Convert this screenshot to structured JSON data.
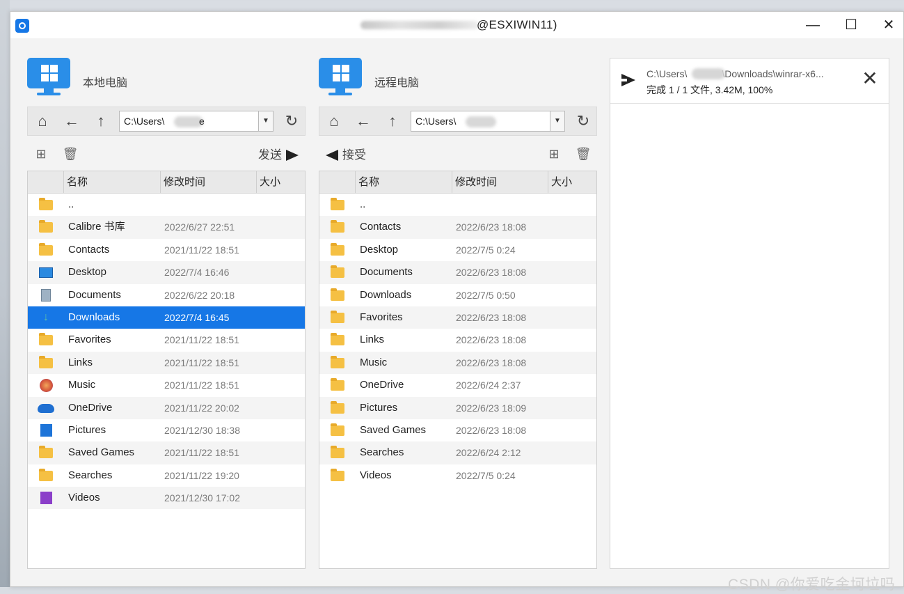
{
  "window": {
    "title": "@ESXIWIN11)",
    "minimize": "—",
    "maximize": "☐",
    "close": "✕"
  },
  "local": {
    "title": "本地电脑",
    "path": "C:\\Users\\",
    "path_suffix": "e",
    "send_label": "发送",
    "columns": [
      "名称",
      "修改时间",
      "大小"
    ],
    "files": [
      {
        "icon": "folder-icon",
        "name": "..",
        "date": ""
      },
      {
        "icon": "folder-icon",
        "name": "Calibre 书库",
        "date": "2022/6/27 22:51"
      },
      {
        "icon": "folder-icon",
        "name": "Contacts",
        "date": "2021/11/22 18:51"
      },
      {
        "icon": "desktop-folder-icon",
        "name": "Desktop",
        "date": "2022/7/4 16:46"
      },
      {
        "icon": "documents-folder-icon",
        "name": "Documents",
        "date": "2022/6/22 20:18"
      },
      {
        "icon": "downloads-folder-icon",
        "name": "Downloads",
        "date": "2022/7/4 16:45",
        "selected": true
      },
      {
        "icon": "folder-icon",
        "name": "Favorites",
        "date": "2021/11/22 18:51"
      },
      {
        "icon": "folder-icon",
        "name": "Links",
        "date": "2021/11/22 18:51"
      },
      {
        "icon": "music-folder-icon",
        "name": "Music",
        "date": "2021/11/22 18:51"
      },
      {
        "icon": "onedrive-icon",
        "name": "OneDrive",
        "date": "2021/11/22 20:02"
      },
      {
        "icon": "pictures-folder-icon",
        "name": "Pictures",
        "date": "2021/12/30 18:38"
      },
      {
        "icon": "folder-icon",
        "name": "Saved Games",
        "date": "2021/11/22 18:51"
      },
      {
        "icon": "folder-icon",
        "name": "Searches",
        "date": "2021/11/22 19:20"
      },
      {
        "icon": "videos-folder-icon",
        "name": "Videos",
        "date": "2021/12/30 17:02"
      }
    ]
  },
  "remote": {
    "title": "远程电脑",
    "path": "C:\\Users\\",
    "recv_label": "接受",
    "columns": [
      "名称",
      "修改时间",
      "大小"
    ],
    "files": [
      {
        "icon": "folder-icon",
        "name": "..",
        "date": ""
      },
      {
        "icon": "folder-icon",
        "name": "Contacts",
        "date": "2022/6/23 18:08"
      },
      {
        "icon": "folder-icon",
        "name": "Desktop",
        "date": "2022/7/5 0:24"
      },
      {
        "icon": "folder-icon",
        "name": "Documents",
        "date": "2022/6/23 18:08"
      },
      {
        "icon": "folder-icon",
        "name": "Downloads",
        "date": "2022/7/5 0:50"
      },
      {
        "icon": "folder-icon",
        "name": "Favorites",
        "date": "2022/6/23 18:08"
      },
      {
        "icon": "folder-icon",
        "name": "Links",
        "date": "2022/6/23 18:08"
      },
      {
        "icon": "folder-icon",
        "name": "Music",
        "date": "2022/6/23 18:08"
      },
      {
        "icon": "folder-icon",
        "name": "OneDrive",
        "date": "2022/6/24 2:37"
      },
      {
        "icon": "folder-icon",
        "name": "Pictures",
        "date": "2022/6/23 18:09"
      },
      {
        "icon": "folder-icon",
        "name": "Saved Games",
        "date": "2022/6/23 18:08"
      },
      {
        "icon": "folder-icon",
        "name": "Searches",
        "date": "2022/6/24 2:12"
      },
      {
        "icon": "folder-icon",
        "name": "Videos",
        "date": "2022/7/5 0:24"
      }
    ]
  },
  "transfer": {
    "path_prefix": "C:\\Users\\",
    "path_suffix": "\\Downloads\\winrar-x6...",
    "status": "完成 1 / 1 文件, 3.42M, 100%",
    "close": "✕"
  },
  "watermark": "CSDN @你爱吃金坷垃吗",
  "colors": {
    "accent": "#1677e6",
    "selected_row": "#1677e6",
    "folder": "#f5c043"
  }
}
